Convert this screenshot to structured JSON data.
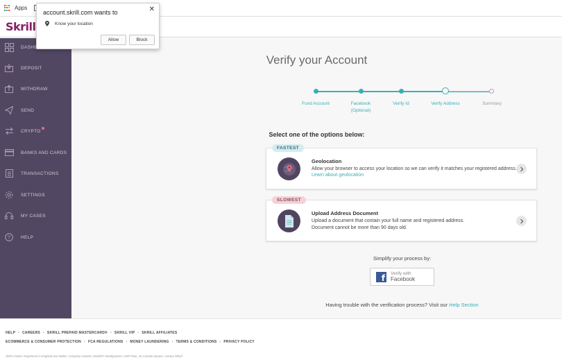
{
  "browser": {
    "bookmarks_apps_label": "Apps",
    "popup": {
      "title": "account.skrill.com wants to",
      "permission": "Know your location",
      "allow_label": "Allow",
      "block_label": "Block",
      "close_glyph": "✕"
    }
  },
  "header": {
    "logo": "Skrill"
  },
  "sidebar": {
    "items": [
      {
        "label": "DASHBOARD",
        "icon": "grid-icon"
      },
      {
        "label": "DEPOSIT",
        "icon": "deposit-icon"
      },
      {
        "label": "WITHDRAW",
        "icon": "withdraw-icon"
      },
      {
        "label": "SEND",
        "icon": "send-icon"
      },
      {
        "label": "CRYPTO",
        "icon": "exchange-icon"
      },
      {
        "label": "BANKS AND CARDS",
        "icon": "card-icon"
      },
      {
        "label": "TRANSACTIONS",
        "icon": "transactions-icon"
      },
      {
        "label": "SETTINGS",
        "icon": "gear-icon"
      },
      {
        "label": "MY CASES",
        "icon": "headset-icon"
      },
      {
        "label": "HELP",
        "icon": "help-icon"
      }
    ]
  },
  "main": {
    "title": "Verify your Account",
    "steps": [
      {
        "label": "Fund Account",
        "sub": ""
      },
      {
        "label": "Facebook",
        "sub": "(Optional)"
      },
      {
        "label": "Verify Id",
        "sub": ""
      },
      {
        "label": "Verify Address",
        "sub": ""
      },
      {
        "label": "Summary",
        "sub": ""
      }
    ],
    "select_text": "Select one of the options below:",
    "options": [
      {
        "badge": "FASTEST",
        "title": "Geolocation",
        "description": "Allow your browser to access your location so we can verify it matches your registered address.",
        "link": "Learn about geolocation"
      },
      {
        "badge": "SLOWEST",
        "title": "Upload Address Document",
        "description_line1": "Upload a document that contain your full name and registered address.",
        "description_line2": "Document cannot be more than 90 days old."
      }
    ],
    "simplify_text": "Simplify your process by:",
    "facebook_button": {
      "line1": "Verify with",
      "line2": "Facebook"
    },
    "trouble_text": "Having trouble with the verification process? Visit our",
    "help_link": "Help Section"
  },
  "footer": {
    "row1": [
      "HELP",
      "CAREERS",
      "SKRILL PREPAID MASTERCARD®",
      "SKRILL VIP",
      "SKRILL AFFILIATES"
    ],
    "row2": [
      "ECOMMERCE & CONSUMER PROTECTION",
      "FCA REGULATIONS",
      "MONEY LAUNDERING",
      "TERMS & CONDITIONS",
      "PRIVACY POLICY"
    ],
    "legal": "Skrill Limited. Registered in England and Wales: Company Number 4260907 Headquarters: 25th Floor, 25 Canada Square, Canary Wharf"
  },
  "colors": {
    "brand": "#862165",
    "sidebar": "#524762",
    "accent": "#3aaeb6",
    "badge_fast": "#d4ecef",
    "badge_slow": "#f5d2d7",
    "facebook": "#3b5998"
  }
}
